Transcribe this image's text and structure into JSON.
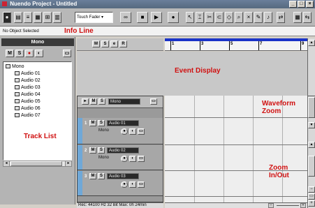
{
  "window": {
    "title": "Nuendo Project - Untitled"
  },
  "toolbar": {
    "track_select": "Touch Fader"
  },
  "info_line": {
    "text": "No Object Selected"
  },
  "inspector": {
    "header": "Mono",
    "tree": {
      "root": "Mono",
      "items": [
        "Audio 01",
        "Audio 02",
        "Audio 03",
        "Audio 04",
        "Audio 05",
        "Audio 06",
        "Audio 07"
      ]
    }
  },
  "ruler": {
    "ticks": [
      "1",
      "3",
      "5",
      "7",
      "9"
    ]
  },
  "track_list": {
    "folder_name": "Mono",
    "tracks": [
      {
        "number": "1",
        "name": "Audio 01",
        "mode": "Mono"
      },
      {
        "number": "2",
        "name": "Audio 02",
        "mode": "Mono"
      },
      {
        "number": "3",
        "name": "Audio 03",
        "mode": ""
      }
    ]
  },
  "status": {
    "text": "Rec: 44100 Hz  32 Bit  Max: 0h 24min"
  },
  "annotations": {
    "info_line": "Info Line",
    "event_display": "Event Display",
    "waveform_zoom": "Waveform Zoom",
    "track_list": "Track List",
    "zoom_inout": "Zoom In/Out"
  },
  "colors": {
    "annotation": "#d01010",
    "ruler_bar": "#1a33c8",
    "track_strip": "#6fa8d8"
  }
}
